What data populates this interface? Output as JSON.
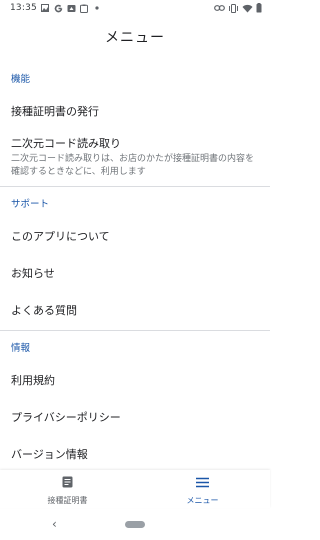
{
  "status_bar": {
    "time": "13:35",
    "left_icons": [
      "image-icon",
      "google-g-icon",
      "drive-icon",
      "clipboard-icon",
      "dot-icon"
    ],
    "right_icons": [
      "link-icon",
      "vibrate-icon",
      "wifi-icon",
      "battery-icon"
    ]
  },
  "app_bar": {
    "title": "メニュー"
  },
  "sections": [
    {
      "header": "機能",
      "items": [
        {
          "label": "接種証明書の発行"
        },
        {
          "label": "二次元コード読み取り",
          "description": "二次元コード読み取りは、お店のかたが接種証明書の内容を確認するときなどに、利用します"
        }
      ]
    },
    {
      "header": "サポート",
      "items": [
        {
          "label": "このアプリについて"
        },
        {
          "label": "お知らせ"
        },
        {
          "label": "よくある質問"
        }
      ]
    },
    {
      "header": "情報",
      "items": [
        {
          "label": "利用規約"
        },
        {
          "label": "プライバシーポリシー"
        },
        {
          "label": "バージョン情報"
        }
      ]
    }
  ],
  "bottom_nav": {
    "items": [
      {
        "label": "接種証明書",
        "icon": "document-icon",
        "active": false
      },
      {
        "label": "メニュー",
        "icon": "menu-icon",
        "active": true
      }
    ]
  },
  "system_nav": {
    "back_glyph": "‹"
  },
  "colors": {
    "accent": "#1a56a8",
    "divider": "#dadce0",
    "secondary_text": "#70757a"
  }
}
